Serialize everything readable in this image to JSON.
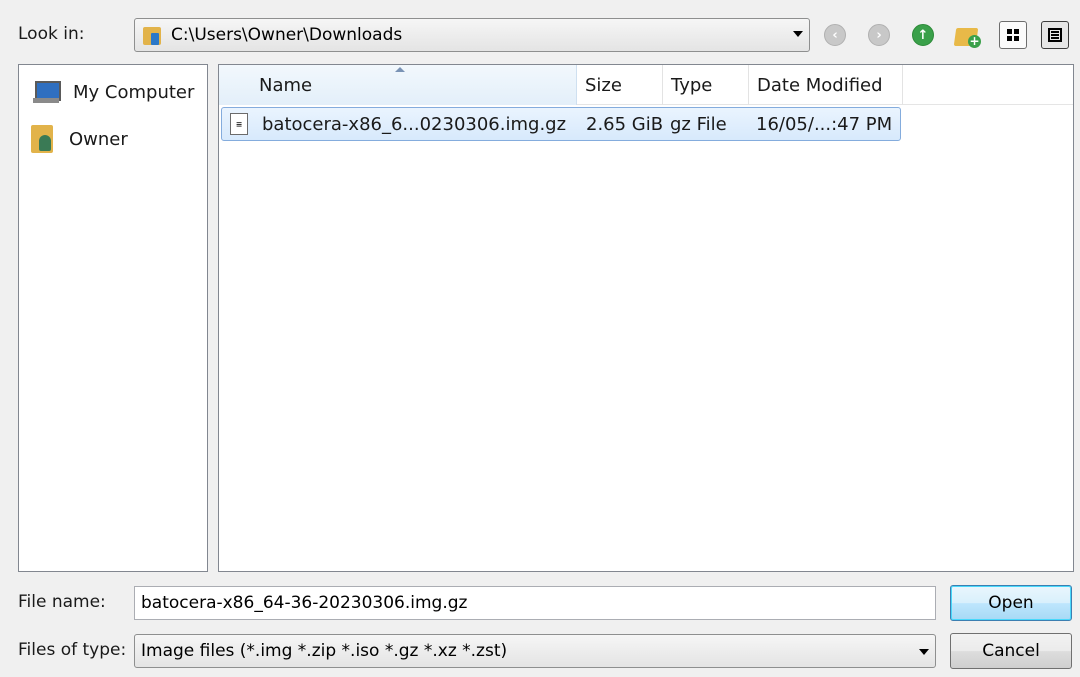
{
  "lookin": {
    "label": "Look in:",
    "path": "C:\\Users\\Owner\\Downloads"
  },
  "toolbar": {
    "icons": [
      "back-icon",
      "forward-icon",
      "up-icon",
      "new-folder-icon",
      "list-view-icon",
      "detail-view-icon"
    ]
  },
  "sidebar": {
    "items": [
      {
        "label": "My Computer",
        "icon": "computer-icon"
      },
      {
        "label": "Owner",
        "icon": "user-folder-icon"
      }
    ]
  },
  "filelist": {
    "columns": [
      "Name",
      "Size",
      "Type",
      "Date Modified"
    ],
    "sorted_column": "Name",
    "rows": [
      {
        "name": "batocera-x86_6...0230306.img.gz",
        "size": "2.65 GiB",
        "type": "gz File",
        "date": "16/05/...:47 PM",
        "selected": true
      }
    ]
  },
  "filename": {
    "label": "File name:",
    "value": "batocera-x86_64-36-20230306.img.gz"
  },
  "filetype": {
    "label": "Files of type:",
    "value": "Image files (*.img *.zip *.iso *.gz *.xz *.zst)"
  },
  "buttons": {
    "open": "Open",
    "cancel": "Cancel"
  },
  "colors": {
    "background": "#f0f0f0",
    "selection": "#d7e9fc",
    "selection_border": "#84acdd"
  }
}
